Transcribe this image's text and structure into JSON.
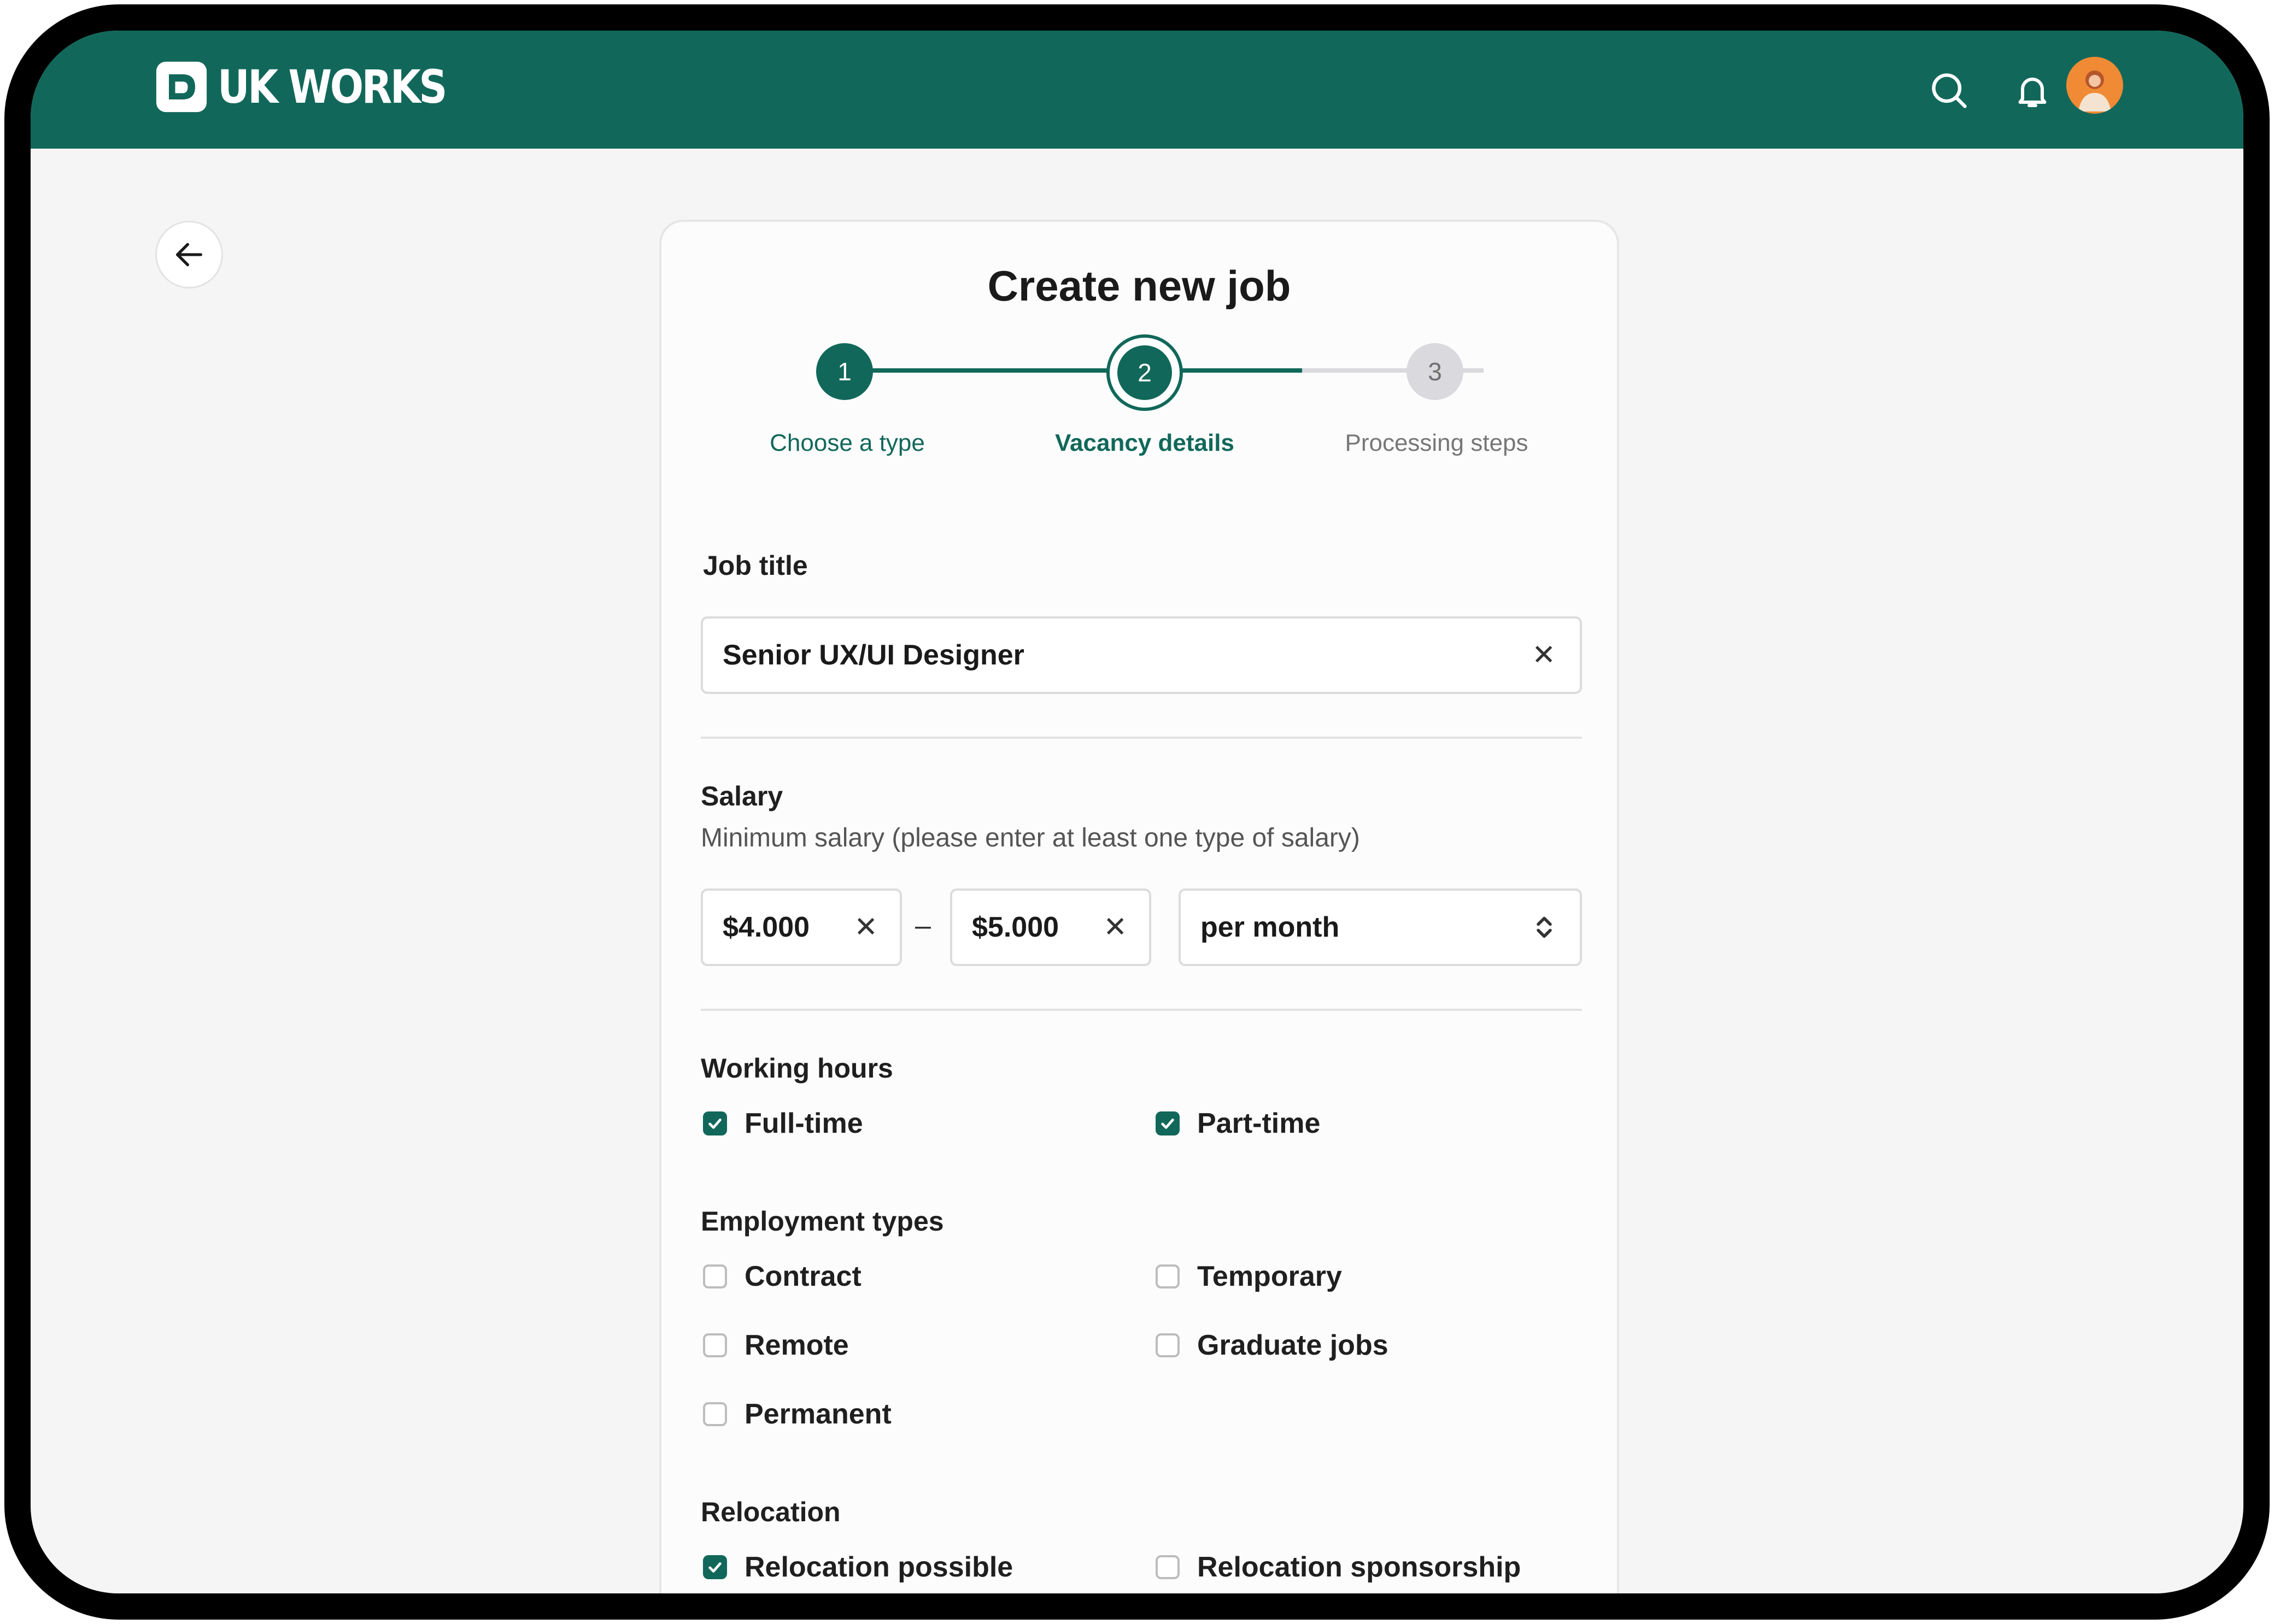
{
  "app": {
    "name": "UK WORKS"
  },
  "topbar": {
    "icons": [
      "search-icon",
      "bell-icon"
    ],
    "avatar": "user-avatar"
  },
  "back": {
    "icon": "arrow-left-icon"
  },
  "page": {
    "title": "Create new job"
  },
  "steps": [
    {
      "number": "1",
      "label": "Choose a type",
      "state": "done"
    },
    {
      "number": "2",
      "label": "Vacancy details",
      "state": "current"
    },
    {
      "number": "3",
      "label": "Processing steps",
      "state": "upcoming"
    }
  ],
  "job_title": {
    "label": "Job title",
    "value": "Senior UX/UI Designer"
  },
  "salary": {
    "label": "Salary",
    "hint": "Minimum salary (please enter at least one type of salary)",
    "min": "$4.000",
    "separator": "–",
    "max": "$5.000",
    "period": "per month"
  },
  "working_hours": {
    "label": "Working hours",
    "options": [
      {
        "label": "Full-time",
        "checked": true
      },
      {
        "label": "Part-time",
        "checked": true
      }
    ]
  },
  "employment_types": {
    "label": "Employment types",
    "options": [
      {
        "label": "Contract",
        "checked": false
      },
      {
        "label": "Temporary",
        "checked": false
      },
      {
        "label": "Remote",
        "checked": false
      },
      {
        "label": "Graduate jobs",
        "checked": false
      },
      {
        "label": "Permanent",
        "checked": false
      }
    ]
  },
  "relocation": {
    "label": "Relocation",
    "options": [
      {
        "label": "Relocation possible",
        "checked": true
      },
      {
        "label": "Relocation sponsorship",
        "checked": false
      }
    ]
  },
  "colors": {
    "brand": "#11685a",
    "background": "#f5f5f5",
    "inactive": "#d9d9de"
  }
}
